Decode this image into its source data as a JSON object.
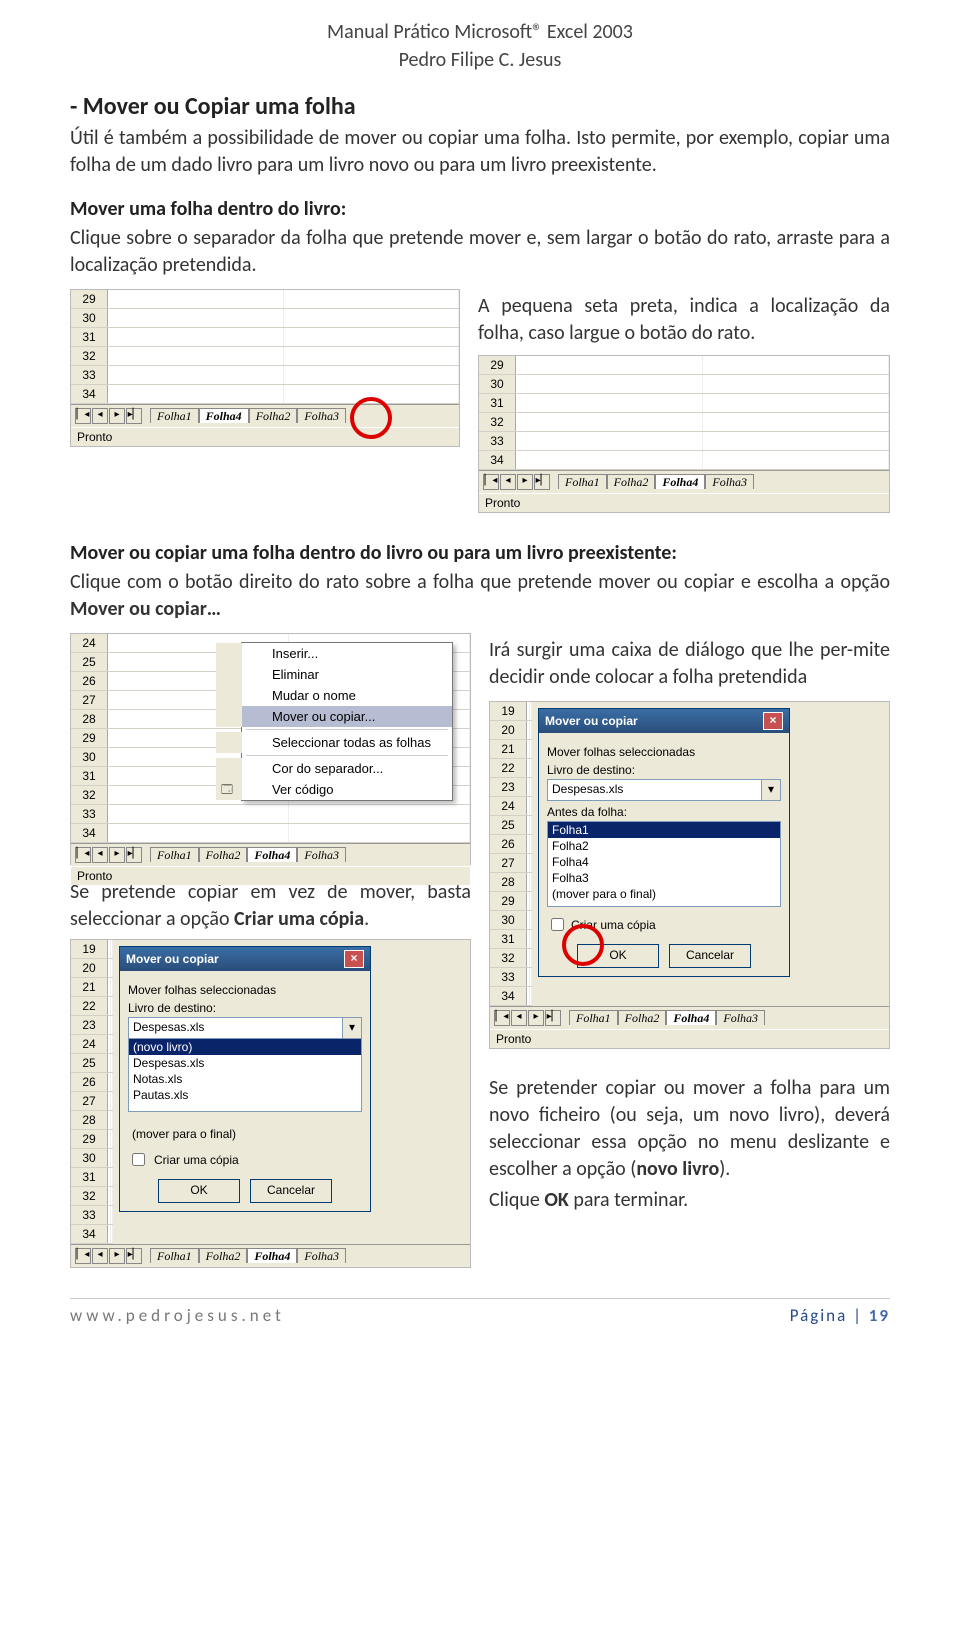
{
  "header": {
    "line1": "Manual Prático Microsoft® Excel 2003",
    "line2": "Pedro Filipe C. Jesus"
  },
  "section1": {
    "title": "- Mover ou Copiar uma folha",
    "p1": "Útil é também a possibilidade de mover ou copiar uma folha. Isto permite, por exemplo, copiar uma folha de um dado livro para um livro novo ou para um livro preexistente."
  },
  "section2": {
    "sub": "Mover uma folha dentro do livro:",
    "p1": "Clique sobre o separador da folha que pretende mover e, sem largar o botão do rato, arraste para a localização pretendida.",
    "p2": "A pequena seta preta, indica a localização da folha, caso largue o botão do rato."
  },
  "section3": {
    "sub": "Mover ou copiar uma folha dentro do livro ou para um livro preexistente:",
    "p1_a": "Clique com o botão direito do rato sobre a folha que pretende mover ou copiar e escolha a opção ",
    "p1_b": "Mover ou copiar…",
    "p2": "Irá surgir uma caixa de diálogo que lhe per-mite decidir onde colocar a folha pretendida",
    "p3_a": "Se pretende copiar em vez de mover, basta seleccionar a opção ",
    "p3_b": "Criar uma cópia",
    "p3_c": ".",
    "p4_a": "Se pretender copiar ou mover a folha para um novo ficheiro (ou seja, um novo livro), deverá seleccionar essa opção no menu deslizante e escolher a opção (",
    "p4_b": "novo livro",
    "p4_c": ").",
    "p5_a": "Clique ",
    "p5_b": "OK",
    "p5_c": " para terminar."
  },
  "figA": {
    "rows": [
      "29",
      "30",
      "31",
      "32",
      "33",
      "34"
    ],
    "tabs": [
      "Folha1",
      "Folha4",
      "Folha2",
      "Folha3"
    ],
    "active": "Folha4",
    "status": "Pronto"
  },
  "figB": {
    "rows": [
      "29",
      "30",
      "31",
      "32",
      "33",
      "34"
    ],
    "tabs": [
      "Folha1",
      "Folha2",
      "Folha4",
      "Folha3"
    ],
    "active": "Folha4",
    "status": "Pronto"
  },
  "figC": {
    "rows": [
      "24",
      "25",
      "26",
      "27",
      "28",
      "29",
      "30",
      "31",
      "32",
      "33",
      "34"
    ],
    "tabs": [
      "Folha1",
      "Folha2",
      "Folha4",
      "Folha3"
    ],
    "status": "Pronto",
    "menu": [
      "Inserir...",
      "Eliminar",
      "Mudar o nome",
      "Mover ou copiar...",
      "Seleccionar todas as folhas",
      "Cor do separador...",
      "Ver código"
    ],
    "menuHover": "Mover ou copiar..."
  },
  "dialog1": {
    "title": "Mover ou copiar",
    "label1": "Mover folhas seleccionadas",
    "label2": "Livro de destino:",
    "combo": "Despesas.xls",
    "label3": "Antes da folha:",
    "list": [
      "Folha1",
      "Folha2",
      "Folha4",
      "Folha3",
      "(mover para o final)"
    ],
    "listSel": "Folha1",
    "chk": "Criar uma cópia",
    "ok": "OK",
    "cancel": "Cancelar"
  },
  "figD_rows": [
    "19",
    "20",
    "21",
    "22",
    "23",
    "24",
    "25",
    "26",
    "27",
    "28",
    "29",
    "30",
    "31",
    "32",
    "33",
    "34"
  ],
  "dialog2": {
    "title": "Mover ou copiar",
    "label1": "Mover folhas seleccionadas",
    "label2": "Livro de destino:",
    "combo": "Despesas.xls",
    "list": [
      "(novo livro)",
      "Despesas.xls",
      "Notas.xls",
      "Pautas.xls"
    ],
    "listSel": "(novo livro)",
    "listEnd": "(mover para o final)",
    "chk": "Criar uma cópia",
    "ok": "OK",
    "cancel": "Cancelar"
  },
  "figE_rows": [
    "19",
    "20",
    "21",
    "22",
    "23",
    "24",
    "25",
    "26",
    "27",
    "28",
    "29",
    "30",
    "31",
    "32",
    "33",
    "34"
  ],
  "footer": {
    "url": "www.pedrojesus.net",
    "pglabel": "Página | ",
    "pgnum": "19"
  }
}
